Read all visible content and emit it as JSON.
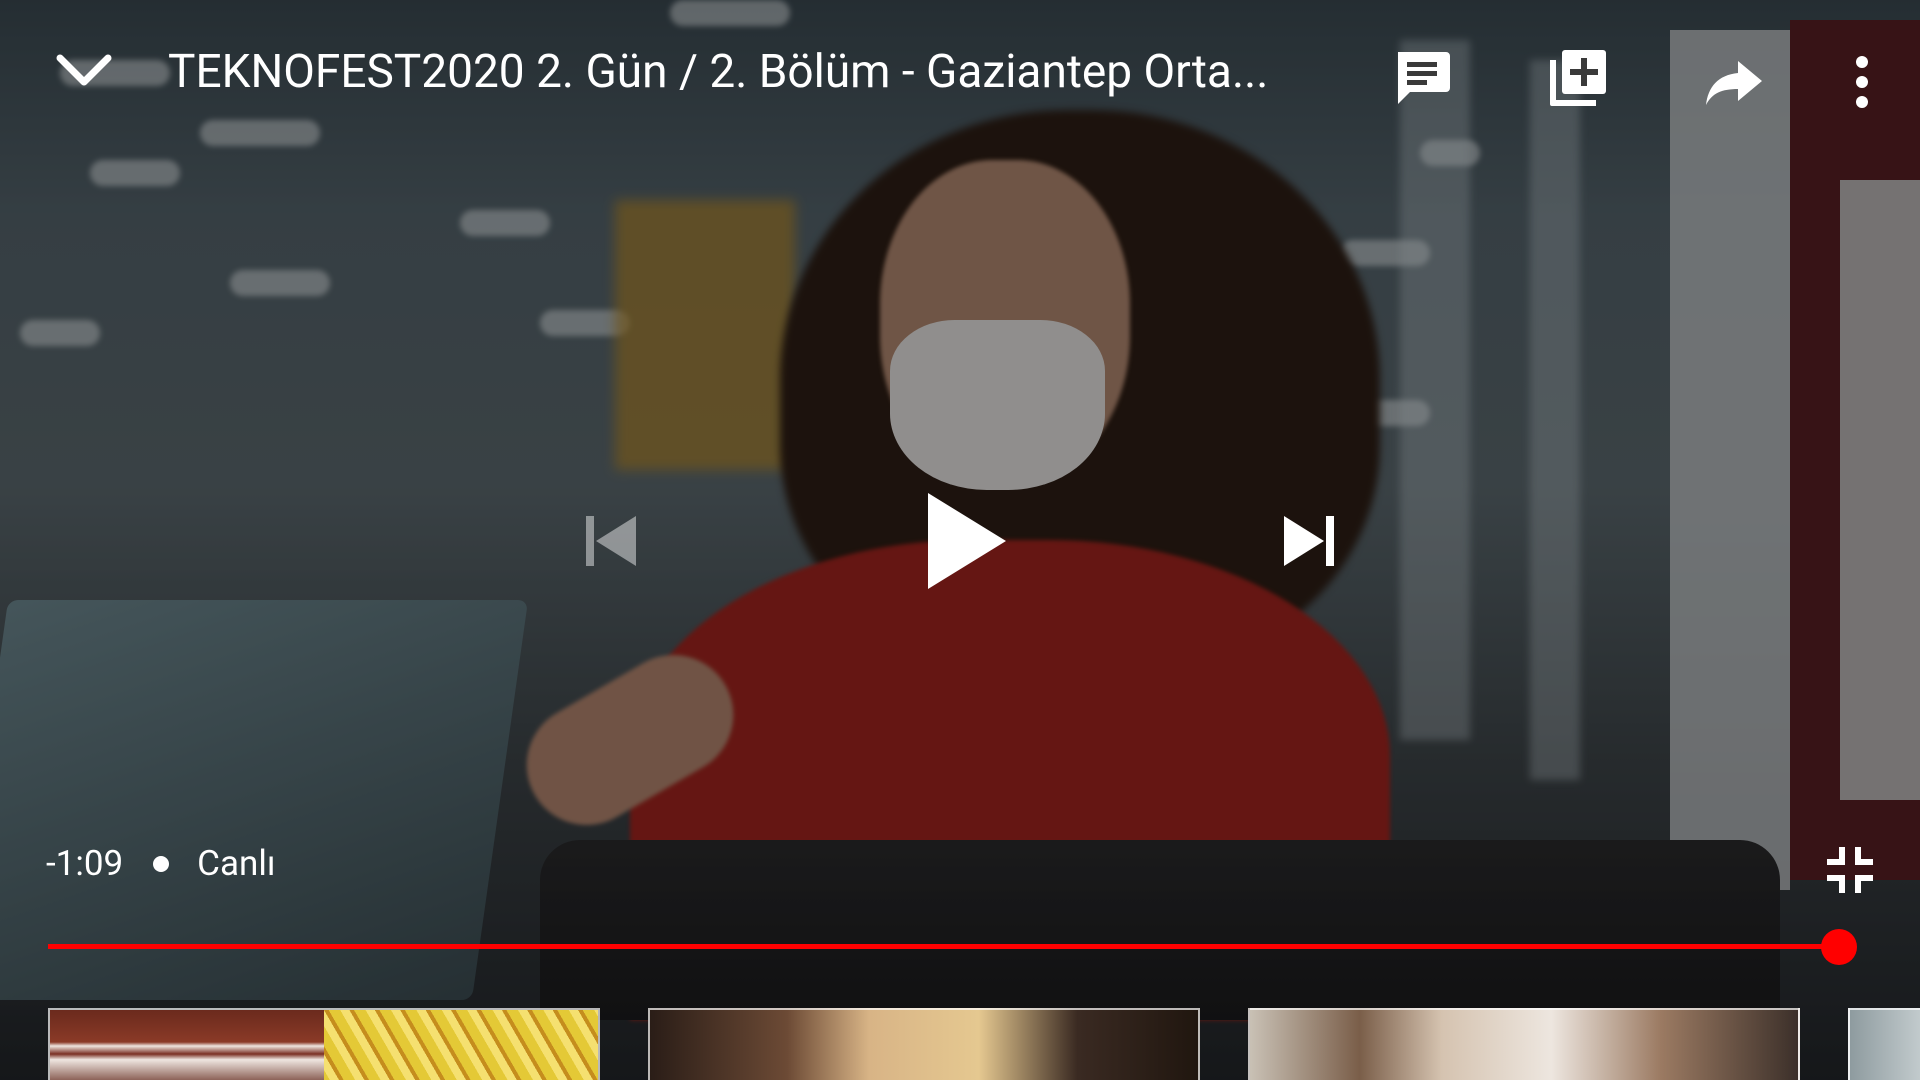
{
  "video": {
    "title": "TEKNOFEST2020 2. Gün / 2. Bölüm  - Gaziantep Orta...",
    "time_remaining": "-1:09",
    "live_label": "Canlı",
    "progress_fraction": 0.993
  },
  "icons": {
    "minimize": "chevron-down-icon",
    "chat": "live-chat-icon",
    "add_to_playlist": "add-to-playlist-icon",
    "share": "share-icon",
    "more": "more-vert-icon",
    "previous": "skip-previous-icon",
    "play": "play-icon",
    "next": "skip-next-icon",
    "exit_fullscreen": "fullscreen-exit-icon"
  },
  "colors": {
    "progress": "#ff0000",
    "icon": "#ffffff"
  },
  "suggestions": [
    {
      "name": "suggestion-1"
    },
    {
      "name": "suggestion-2"
    },
    {
      "name": "suggestion-3"
    },
    {
      "name": "suggestion-4"
    }
  ]
}
